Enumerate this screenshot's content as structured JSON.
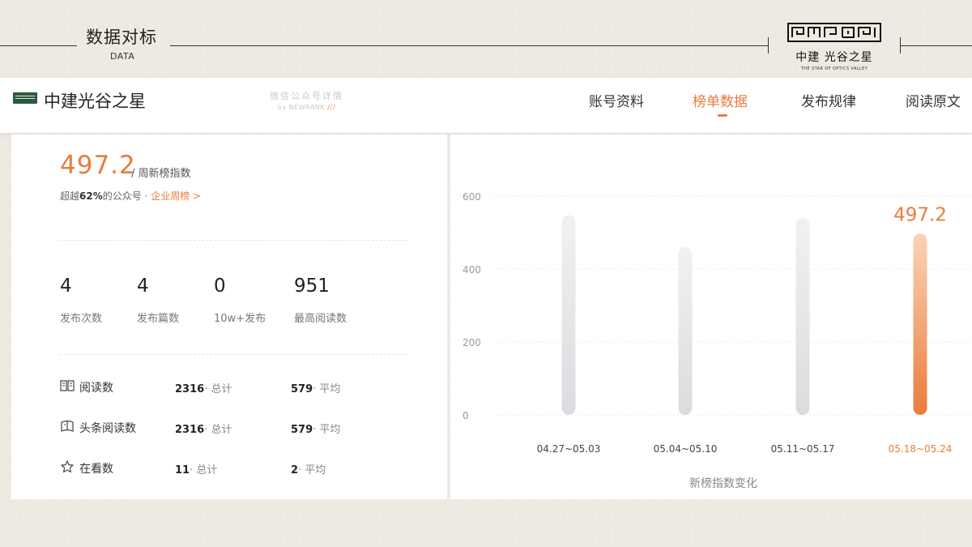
{
  "header": {
    "title": "数据对标",
    "subtitle": "DATA",
    "brand_name": "中建 光谷之星",
    "brand_en": "THE STAR OF OPTICS VALLEY"
  },
  "appbar": {
    "account_name": "中建光谷之星",
    "watermark_line1": "微信公众号详情",
    "watermark_line2": "by NEWRANK",
    "watermark_mark": "///",
    "nav": [
      {
        "label": "账号资料"
      },
      {
        "label": "榜单数据"
      },
      {
        "label": "发布规律"
      },
      {
        "label": "阅读原文"
      }
    ]
  },
  "summary": {
    "score": "497.2",
    "score_unit": "/ 周新榜指数",
    "beat_prefix": "超越",
    "beat_pct": "62%",
    "beat_suffix": "的公众号 · ",
    "beat_link": "企业周榜 >"
  },
  "stats": [
    {
      "value": "4",
      "label": "发布次数"
    },
    {
      "value": "4",
      "label": "发布篇数"
    },
    {
      "value": "0",
      "label": "10w+发布"
    },
    {
      "value": "951",
      "label": "最高阅读数"
    }
  ],
  "reads": [
    {
      "icon": "book-icon",
      "label": "阅读数",
      "total": "2316",
      "total_suffix": "· 总计",
      "avg": "579",
      "avg_suffix": "· 平均"
    },
    {
      "icon": "headline-book-icon",
      "label": "头条阅读数",
      "total": "2316",
      "total_suffix": "· 总计",
      "avg": "579",
      "avg_suffix": "· 平均"
    },
    {
      "icon": "star-icon",
      "label": "在看数",
      "total": "11",
      "total_suffix": "· 总计",
      "avg": "2",
      "avg_suffix": "· 平均"
    }
  ],
  "colors": {
    "accent": "#ea7b3c",
    "bar_gray": "#e4e4e7",
    "text": "#222222"
  },
  "chart_data": {
    "type": "bar",
    "title": "新榜指数变化",
    "categories": [
      "04.27~05.03",
      "05.04~05.10",
      "05.11~05.17",
      "05.18~05.24"
    ],
    "values": [
      548,
      460,
      540,
      497.2
    ],
    "highlight_label": "497.2",
    "highlight_index": 3,
    "ylim": [
      0,
      600
    ],
    "yticks": [
      "0",
      "200",
      "400",
      "600"
    ],
    "grid": true
  }
}
